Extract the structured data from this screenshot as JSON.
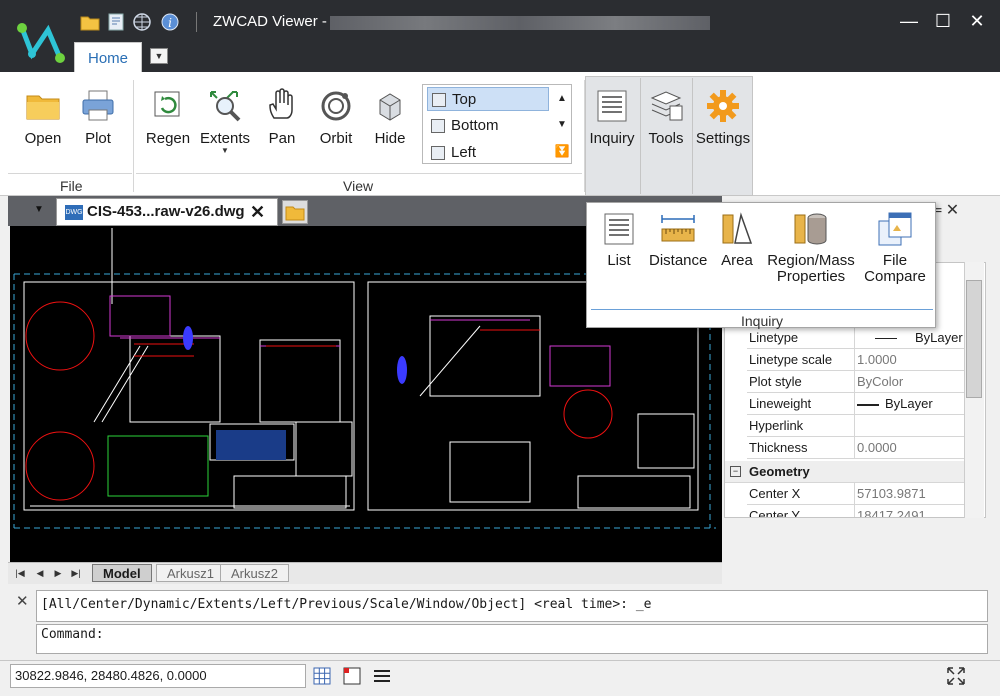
{
  "window": {
    "title": "ZWCAD Viewer -",
    "controls": {
      "minimize": "—",
      "maximize": "☐",
      "close": "✕"
    }
  },
  "quick_access": [
    "folder-icon",
    "print-settings-icon",
    "web-icon",
    "info-icon"
  ],
  "ribbon_tabs": [
    {
      "label": "Home",
      "active": true
    }
  ],
  "ribbon": {
    "file_group": {
      "label": "File",
      "buttons": [
        {
          "label": "Open",
          "icon": "folder-open-icon"
        },
        {
          "label": "Plot",
          "icon": "printer-icon"
        }
      ]
    },
    "view_group": {
      "label": "View",
      "buttons": [
        {
          "label": "Regen",
          "icon": "regen-icon"
        },
        {
          "label": "Extents",
          "icon": "zoom-extents-icon",
          "has_dropdown": true
        },
        {
          "label": "Pan",
          "icon": "hand-icon"
        },
        {
          "label": "Orbit",
          "icon": "orbit-icon"
        },
        {
          "label": "Hide",
          "icon": "hide-icon"
        }
      ],
      "views": [
        {
          "label": "Top",
          "selected": true
        },
        {
          "label": "Bottom"
        },
        {
          "label": "Left"
        }
      ]
    },
    "inquiry": {
      "label": "Inquiry",
      "icon": "inquiry-icon"
    },
    "tools": {
      "label": "Tools",
      "icon": "tools-icon"
    },
    "settings": {
      "label": "Settings",
      "icon": "gear-icon"
    }
  },
  "inquiry_dropdown": {
    "items": [
      {
        "label": "List",
        "icon": "list-icon"
      },
      {
        "label": "Distance",
        "icon": "ruler-icon"
      },
      {
        "label": "Area",
        "icon": "area-icon"
      },
      {
        "label": "Region/Mass",
        "label2": "Properties",
        "icon": "mass-properties-icon"
      },
      {
        "label": "File",
        "label2": "Compare",
        "icon": "file-compare-icon"
      }
    ],
    "group_label": "Inquiry"
  },
  "document_tab": {
    "title": "CIS-453...raw-v26.dwg",
    "close": "✕",
    "badge": "DWG"
  },
  "layout_tabs": [
    {
      "label": "Model",
      "active": true
    },
    {
      "label": "Arkusz1"
    },
    {
      "label": "Arkusz2"
    }
  ],
  "properties": {
    "rows": [
      {
        "name": "Linetype",
        "value": "ByLayer",
        "line": true
      },
      {
        "name": "Linetype scale",
        "value": "1.0000",
        "gray": true
      },
      {
        "name": "Plot style",
        "value": "ByColor",
        "gray": true
      },
      {
        "name": "Lineweight",
        "value": "ByLayer",
        "thick": true
      },
      {
        "name": "Hyperlink",
        "value": ""
      },
      {
        "name": "Thickness",
        "value": "0.0000",
        "gray": true
      }
    ],
    "geometry_group": "Geometry",
    "geometry_rows": [
      {
        "name": "Center X",
        "value": "57103.9871",
        "gray": true
      },
      {
        "name": "Center Y",
        "value": "18417.2491",
        "gray": true
      }
    ]
  },
  "command": {
    "history": "[All/Center/Dynamic/Extents/Left/Previous/Scale/Window/Object] <real time>: _e",
    "prompt": "Command:"
  },
  "status": {
    "coordinates": "30822.9846, 28480.4826, 0.0000"
  },
  "colors": {
    "titlebar": "#2b2d31",
    "accent": "#2a6fb5",
    "canvas": "#000000",
    "selection": "#cde0f6"
  }
}
